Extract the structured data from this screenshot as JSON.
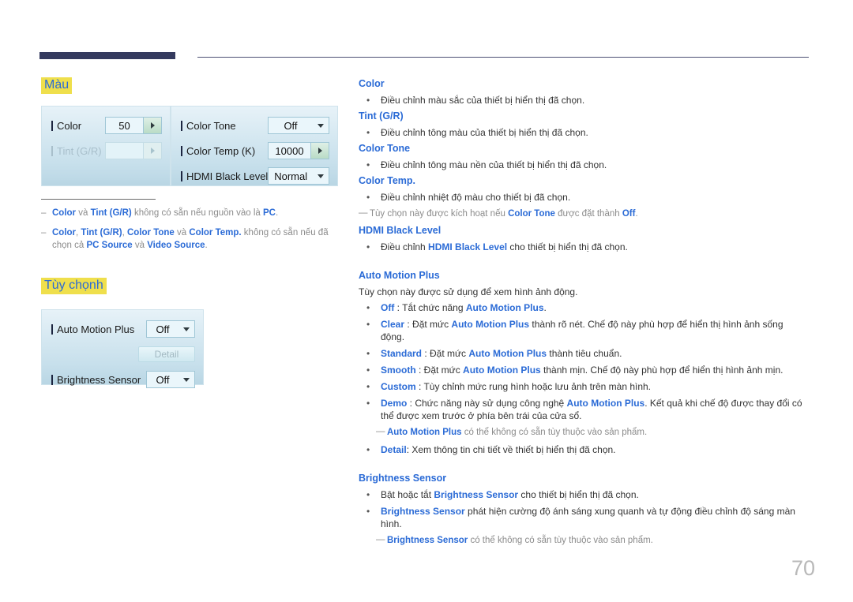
{
  "page": {
    "number": "70"
  },
  "sections": {
    "color": {
      "title": "Màu",
      "panel_left": {
        "rows": [
          {
            "label": "Color",
            "value": "50",
            "control": "stepper",
            "disabled": false
          },
          {
            "label": "Tint (G/R)",
            "value": "",
            "control": "stepper",
            "disabled": true
          }
        ]
      },
      "panel_right": {
        "rows": [
          {
            "label": "Color Tone",
            "value": "Off",
            "control": "dropdown",
            "disabled": false
          },
          {
            "label": "Color Temp (K)",
            "value": "10000",
            "control": "stepper",
            "disabled": false
          },
          {
            "label": "HDMI Black Level",
            "value": "Normal",
            "control": "dropdown",
            "disabled": false
          }
        ]
      },
      "notes": [
        {
          "dash": "–",
          "parts": [
            {
              "t": "Color",
              "b": true
            },
            {
              "t": " và "
            },
            {
              "t": "Tint (G/R)",
              "b": true
            },
            {
              "t": " không có sẵn nếu nguồn vào là "
            },
            {
              "t": "PC",
              "b": true
            },
            {
              "t": "."
            }
          ]
        },
        {
          "dash": "–",
          "parts": [
            {
              "t": "Color",
              "b": true
            },
            {
              "t": ", "
            },
            {
              "t": "Tint (G/R)",
              "b": true
            },
            {
              "t": ", "
            },
            {
              "t": "Color Tone",
              "b": true
            },
            {
              "t": " và "
            },
            {
              "t": "Color Temp.",
              "b": true
            },
            {
              "t": " không có sẵn nếu đã chọn cả "
            },
            {
              "t": "PC Source",
              "b": true
            },
            {
              "t": " và "
            },
            {
              "t": "Video Source",
              "b": true
            },
            {
              "t": "."
            }
          ]
        }
      ]
    },
    "options": {
      "title": "Tùy chọnh",
      "panel": {
        "rows": [
          {
            "label": "Auto Motion Plus",
            "value": "Off",
            "control": "dropdown",
            "disabled": false
          },
          {
            "label": "",
            "value": "Detail",
            "control": "button",
            "disabled": true
          },
          {
            "label": "Brightness Sensor",
            "value": "Off",
            "control": "dropdown",
            "disabled": false
          }
        ]
      }
    }
  },
  "right_column": {
    "blocks": [
      {
        "type": "head",
        "text": "Color"
      },
      {
        "type": "bullet",
        "parts": [
          {
            "t": "Điều chỉnh màu sắc của thiết bị hiển thị đã chọn."
          }
        ]
      },
      {
        "type": "head",
        "text": "Tint (G/R)"
      },
      {
        "type": "bullet",
        "parts": [
          {
            "t": "Điều chỉnh tông màu của thiết bị hiển thị đã chọn."
          }
        ]
      },
      {
        "type": "head",
        "text": "Color Tone"
      },
      {
        "type": "bullet",
        "parts": [
          {
            "t": "Điều chỉnh tông màu nền của thiết bị hiển thị đã chọn."
          }
        ]
      },
      {
        "type": "head",
        "text": "Color Temp."
      },
      {
        "type": "bullet",
        "parts": [
          {
            "t": "Điều chỉnh nhiệt độ màu cho thiết bị đã chọn."
          }
        ]
      },
      {
        "type": "note",
        "dash": "—",
        "parts": [
          {
            "t": "Tùy chọn này được kích hoạt nếu "
          },
          {
            "t": "Color Tone",
            "b": true
          },
          {
            "t": " được đặt thành "
          },
          {
            "t": "Off",
            "b": true
          },
          {
            "t": "."
          }
        ]
      },
      {
        "type": "head",
        "text": "HDMI Black Level"
      },
      {
        "type": "bullet",
        "parts": [
          {
            "t": "Điều chỉnh "
          },
          {
            "t": "HDMI Black Level",
            "b": true
          },
          {
            "t": " cho thiết bị hiển thị đã chọn."
          }
        ]
      },
      {
        "type": "gap"
      },
      {
        "type": "head",
        "text": "Auto Motion Plus"
      },
      {
        "type": "plain",
        "text": "Tùy chọn này được sử dụng để xem hình ảnh động."
      },
      {
        "type": "bullet",
        "parts": [
          {
            "t": "Off",
            "b": true
          },
          {
            "t": " : Tắt chức năng "
          },
          {
            "t": "Auto Motion Plus",
            "b": true
          },
          {
            "t": "."
          }
        ]
      },
      {
        "type": "bullet",
        "parts": [
          {
            "t": "Clear",
            "b": true
          },
          {
            "t": " : Đặt mức "
          },
          {
            "t": "Auto Motion Plus",
            "b": true
          },
          {
            "t": " thành rõ nét. Chế độ này phù hợp để hiển thị hình ảnh sống động."
          }
        ]
      },
      {
        "type": "bullet",
        "parts": [
          {
            "t": "Standard",
            "b": true
          },
          {
            "t": " : Đặt mức "
          },
          {
            "t": "Auto Motion Plus",
            "b": true
          },
          {
            "t": " thành tiêu chuẩn."
          }
        ]
      },
      {
        "type": "bullet",
        "parts": [
          {
            "t": "Smooth",
            "b": true
          },
          {
            "t": " : Đặt mức "
          },
          {
            "t": "Auto Motion Plus",
            "b": true
          },
          {
            "t": " thành mịn. Chế độ này phù hợp để hiển thị hình ảnh mịn."
          }
        ]
      },
      {
        "type": "bullet",
        "parts": [
          {
            "t": "Custom",
            "b": true
          },
          {
            "t": " : Tùy chỉnh mức rung hình hoặc lưu ảnh trên màn hình."
          }
        ]
      },
      {
        "type": "bullet",
        "parts": [
          {
            "t": "Demo",
            "b": true
          },
          {
            "t": " : Chức năng này sử dụng công nghệ "
          },
          {
            "t": "Auto Motion Plus",
            "b": true
          },
          {
            "t": ". Kết quả khi chế độ được thay đổi có thể được xem trước ở phía bên trái của cửa sổ."
          }
        ]
      },
      {
        "type": "note-indent",
        "dash": "—",
        "parts": [
          {
            "t": "Auto Motion Plus",
            "b": true
          },
          {
            "t": " có thể không có sẵn tùy thuộc vào sản phẩm."
          }
        ]
      },
      {
        "type": "bullet",
        "parts": [
          {
            "t": "Detail",
            "b": true
          },
          {
            "t": ": Xem thông tin chi tiết về thiết bị hiển thị đã chọn."
          }
        ]
      },
      {
        "type": "gap"
      },
      {
        "type": "head",
        "text": "Brightness Sensor"
      },
      {
        "type": "bullet",
        "parts": [
          {
            "t": "Bật hoặc tắt "
          },
          {
            "t": "Brightness Sensor",
            "b": true
          },
          {
            "t": " cho thiết bị hiển thị đã chọn."
          }
        ]
      },
      {
        "type": "bullet",
        "parts": [
          {
            "t": "Brightness Sensor",
            "b": true
          },
          {
            "t": " phát hiện cường độ ánh sáng xung quanh và tự động điều chỉnh độ sáng màn hình."
          }
        ]
      },
      {
        "type": "note-indent",
        "dash": "—",
        "parts": [
          {
            "t": "Brightness Sensor",
            "b": true
          },
          {
            "t": " có thể không có sẵn tùy thuộc vào sản phẩm."
          }
        ]
      }
    ]
  },
  "colors": {
    "heading_text": "#2b6bd6",
    "heading_highlight": "#efdf4c",
    "header_bar": "#343a5e",
    "note_text": "#8b8b8b",
    "page_number": "#b9b9b9"
  }
}
